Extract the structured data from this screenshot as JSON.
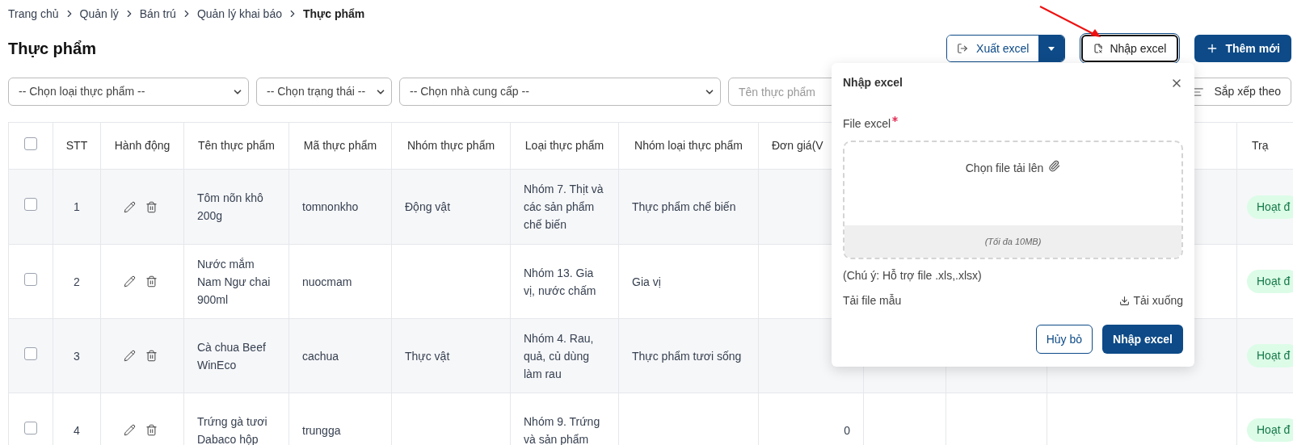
{
  "breadcrumb": [
    {
      "label": "Trang chủ",
      "current": false
    },
    {
      "label": "Quản lý",
      "current": false
    },
    {
      "label": "Bán trú",
      "current": false
    },
    {
      "label": "Quản lý khai báo",
      "current": false
    },
    {
      "label": "Thực phẩm",
      "current": true
    }
  ],
  "title": "Thực phẩm",
  "actions": {
    "export": "Xuất excel",
    "import": "Nhập excel",
    "add": "Thêm mới"
  },
  "filters": {
    "selects": [
      "-- Chọn loại thực phẩm --",
      "-- Chọn trạng thái --",
      "-- Chọn nhà cung cấp --"
    ],
    "name_placeholder": "Tên thực phẩm",
    "sort": "Sắp xếp theo"
  },
  "table": {
    "select_all": {
      "checked": false
    },
    "columns": [
      "STT",
      "Hành động",
      "Tên thực phẩm",
      "Mã thực phẩm",
      "Nhóm thực phẩm",
      "Loại thực phẩm",
      "Nhóm loại thực phẩm",
      "Đơn giá(V",
      "Trạ"
    ],
    "rows": [
      {
        "checked": false,
        "stt": "1",
        "name": "Tôm nõn khô 200g",
        "code": "tomnonkho",
        "group": "Động vật",
        "type": "Nhóm 7. Thịt và các sản phẩm chế biến",
        "type_group": "Thực phẩm chế biến",
        "status": "Hoạt đ"
      },
      {
        "checked": false,
        "stt": "2",
        "name": "Nước mắm Nam Ngư chai 900ml",
        "code": "nuocmam",
        "type": "Nhóm 13. Gia vị, nước chấm",
        "type_group": "Gia vị",
        "status": "Hoạt đ"
      },
      {
        "checked": false,
        "stt": "3",
        "name": "Cà chua Beef WinEco",
        "code": "cachua",
        "group": "Thực vật",
        "type": "Nhóm 4. Rau, quả, củ dùng làm rau",
        "type_group": "Thực phẩm tươi sống",
        "status": "Hoạt đ"
      },
      {
        "checked": false,
        "stt": "4",
        "name": "Trứng gà tươi Dabaco hộp",
        "code": "trungga",
        "type": "Nhóm 9. Trứng và sản phẩm",
        "price": "0",
        "status": "Hoạt đ"
      }
    ]
  },
  "dialog": {
    "title": "Nhập excel",
    "field_label": "File excel",
    "required": true,
    "upload_text": "Chọn file tải lên",
    "limit": "(Tối đa 10MB)",
    "note": "(Chú ý: Hỗ trợ file .xls,.xlsx)",
    "template_label": "Tải file mẫu",
    "download": "Tải xuống",
    "cancel": "Hủy bỏ",
    "submit": "Nhập excel"
  }
}
